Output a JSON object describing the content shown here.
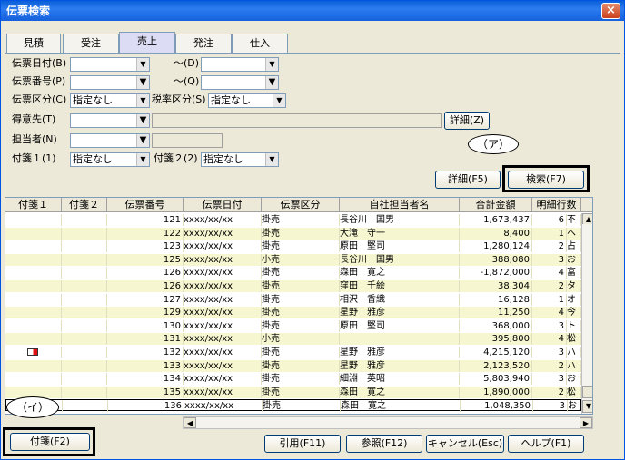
{
  "window": {
    "title": "伝票検索",
    "close": "×"
  },
  "tabs": [
    "見積",
    "受注",
    "売上",
    "発注",
    "仕入"
  ],
  "form": {
    "date_label": "伝票日付(B)",
    "date_to": "～(D)",
    "num_label": "伝票番号(P)",
    "num_to": "～(Q)",
    "kind_label": "伝票区分(C)",
    "kind_value": "指定なし",
    "tax_label": "税率区分(S)",
    "tax_value": "指定なし",
    "customer_label": "得意先(T)",
    "detail_z": "詳細(Z)",
    "staff_label": "担当者(N)",
    "tag1_label": "付箋１(1)",
    "tag1_value": "指定なし",
    "tag2_label": "付箋２(2)",
    "tag2_value": "指定なし"
  },
  "buttons": {
    "detail_f5": "詳細(F5)",
    "search": "検索(F7)",
    "tag": "付箋(F2)",
    "quote": "引用(F11)",
    "ref": "参照(F12)",
    "cancel": "キャンセル(Esc)",
    "help": "ヘルプ(F1)"
  },
  "callouts": {
    "a": "（ア）",
    "i": "（イ）"
  },
  "grid": {
    "headers": [
      "付箋１",
      "付箋２",
      "伝票番号",
      "伝票日付",
      "伝票区分",
      "自社担当者名",
      "合計金額",
      "明細行数"
    ],
    "rows": [
      [
        "",
        "",
        "121",
        "xxxx/xx/xx",
        "掛売",
        "長谷川　国男",
        "1,673,437",
        "6",
        "不"
      ],
      [
        "",
        "",
        "122",
        "xxxx/xx/xx",
        "掛売",
        "大滝　守一",
        "8,400",
        "1",
        "ヘ"
      ],
      [
        "",
        "",
        "123",
        "xxxx/xx/xx",
        "掛売",
        "原田　堅司",
        "1,280,124",
        "2",
        "占"
      ],
      [
        "",
        "",
        "125",
        "xxxx/xx/xx",
        "小売",
        "長谷川　国男",
        "388,080",
        "3",
        "お"
      ],
      [
        "",
        "",
        "126",
        "xxxx/xx/xx",
        "掛売",
        "森田　寛之",
        "-1,872,000",
        "4",
        "富"
      ],
      [
        "",
        "",
        "126",
        "xxxx/xx/xx",
        "掛売",
        "窪田　千絵",
        "38,304",
        "2",
        "タ"
      ],
      [
        "",
        "",
        "127",
        "xxxx/xx/xx",
        "掛売",
        "相沢　香織",
        "16,128",
        "1",
        "オ"
      ],
      [
        "",
        "",
        "129",
        "xxxx/xx/xx",
        "掛売",
        "星野　雅彦",
        "11,250",
        "4",
        "今"
      ],
      [
        "",
        "",
        "130",
        "xxxx/xx/xx",
        "掛売",
        "原田　堅司",
        "368,000",
        "3",
        "ト"
      ],
      [
        "",
        "",
        "131",
        "xxxx/xx/xx",
        "小売",
        "",
        "395,800",
        "4",
        "松"
      ],
      [
        "tag",
        "",
        "132",
        "xxxx/xx/xx",
        "掛売",
        "星野　雅彦",
        "4,215,120",
        "3",
        "ハ"
      ],
      [
        "",
        "",
        "133",
        "xxxx/xx/xx",
        "掛売",
        "星野　雅彦",
        "2,123,520",
        "2",
        "ハ"
      ],
      [
        "",
        "",
        "134",
        "xxxx/xx/xx",
        "掛売",
        "細淵　英昭",
        "5,803,940",
        "3",
        "お"
      ],
      [
        "",
        "",
        "135",
        "xxxx/xx/xx",
        "掛売",
        "森田　寛之",
        "1,890,000",
        "2",
        "松"
      ],
      [
        "",
        "",
        "136",
        "xxxx/xx/xx",
        "掛売",
        "森田　寛之",
        "1,048,350",
        "3",
        "お"
      ]
    ]
  }
}
